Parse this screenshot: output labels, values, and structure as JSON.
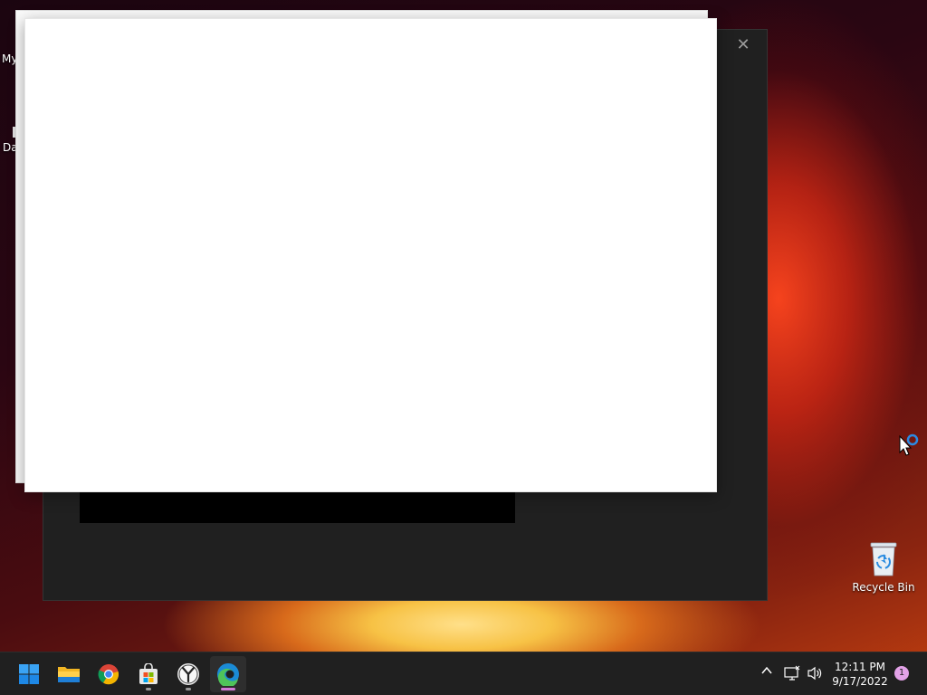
{
  "desktop": {
    "left_labels": [
      "My",
      "Da"
    ],
    "recycle_bin_label": "Recycle Bin"
  },
  "dialog": {
    "close_glyph": "✕"
  },
  "taskbar": {
    "apps": [
      {
        "name": "start",
        "icon": "windows-start-icon"
      },
      {
        "name": "file-explorer",
        "icon": "folder-icon"
      },
      {
        "name": "chrome",
        "icon": "chrome-icon"
      },
      {
        "name": "microsoft-store",
        "icon": "store-icon"
      },
      {
        "name": "clock-app",
        "icon": "clock-icon"
      },
      {
        "name": "edge",
        "icon": "edge-icon"
      }
    ],
    "tray": {
      "chevron": "^",
      "time": "12:11 PM",
      "date": "9/17/2022",
      "notification_count": "1"
    }
  },
  "colors": {
    "taskbar_bg": "#202020",
    "dialog_bg": "#202020",
    "active_indicator": "#d07ad6"
  }
}
